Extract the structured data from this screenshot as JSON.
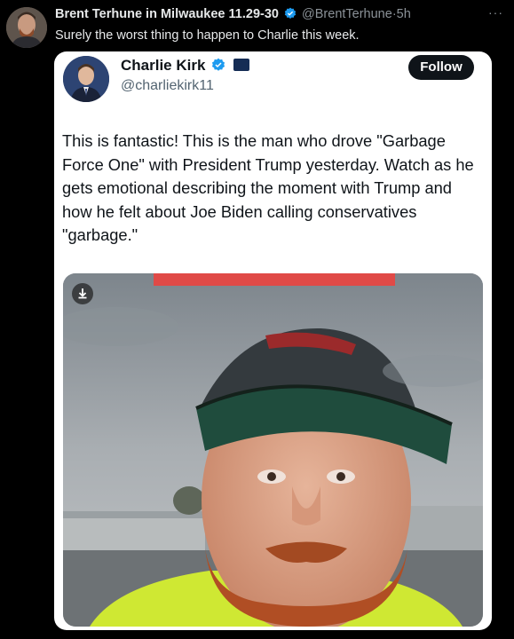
{
  "outer_tweet": {
    "author_name": "Brent Terhune in Milwaukee 11.29-30",
    "handle": "@BrentTerhune",
    "separator": "·",
    "time": "5h",
    "text": "Surely the worst thing to happen to Charlie this week.",
    "more_icon": "more-horizontal-icon"
  },
  "quoted_tweet": {
    "author_name": "Charlie Kirk",
    "handle": "@charliekirk11",
    "follow_label": "Follow",
    "body": "This is fantastic! This is the man who drove \"Garbage Force One\" with President Trump yesterday. Watch as he gets emotional describing the moment with Trump and how he felt about Joe Biden calling conservatives \"garbage.\"",
    "media": {
      "type": "video-still",
      "download_icon": "download-icon"
    }
  },
  "colors": {
    "verified": "#1d9bf0",
    "background": "#000000",
    "card": "#ffffff",
    "follow_button": "#0f1419"
  }
}
